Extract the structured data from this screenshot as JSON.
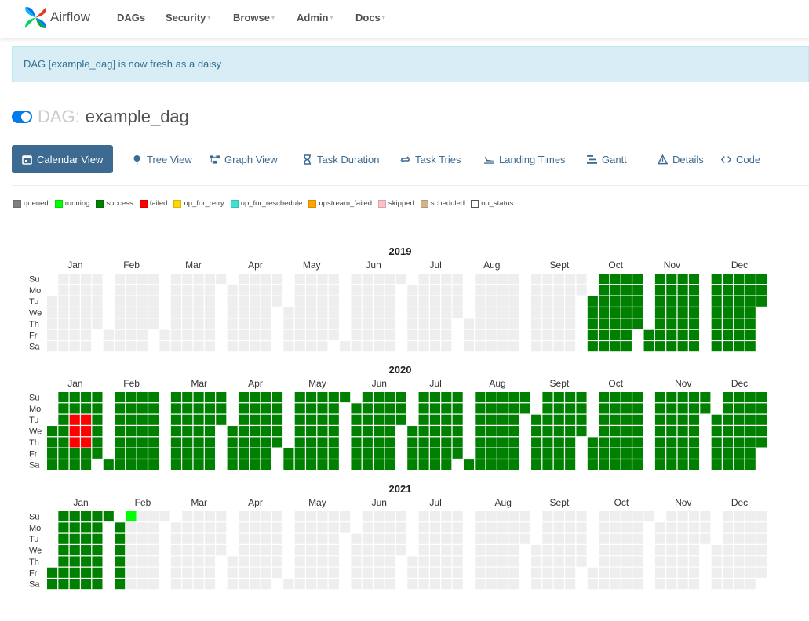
{
  "navbar": {
    "brand": "Airflow",
    "items": [
      {
        "label": "DAGs",
        "caret": false
      },
      {
        "label": "Security",
        "caret": true
      },
      {
        "label": "Browse",
        "caret": true
      },
      {
        "label": "Admin",
        "caret": true
      },
      {
        "label": "Docs",
        "caret": true
      }
    ]
  },
  "alert": {
    "message": "DAG [example_dag] is now fresh as a daisy"
  },
  "dag": {
    "prefix": "DAG:",
    "name": "example_dag",
    "paused": false
  },
  "tabs": [
    {
      "label": "Calendar View",
      "icon": "calendar-icon",
      "active": true
    },
    {
      "label": "Tree View",
      "icon": "pin-icon",
      "active": false
    },
    {
      "label": "Graph View",
      "icon": "graph-icon",
      "active": false
    },
    {
      "label": "Task Duration",
      "icon": "hourglass-icon",
      "active": false
    },
    {
      "label": "Task Tries",
      "icon": "retry-icon",
      "active": false
    },
    {
      "label": "Landing Times",
      "icon": "plane-landing-icon",
      "active": false
    },
    {
      "label": "Gantt",
      "icon": "gantt-icon",
      "active": false
    },
    {
      "label": "Details",
      "icon": "warning-triangle-icon",
      "active": false
    },
    {
      "label": "Code",
      "icon": "code-icon",
      "active": false
    }
  ],
  "legend": [
    {
      "label": "queued",
      "color": "#808080"
    },
    {
      "label": "running",
      "color": "#00ff00"
    },
    {
      "label": "success",
      "color": "#008000"
    },
    {
      "label": "failed",
      "color": "#ff0000"
    },
    {
      "label": "up_for_retry",
      "color": "#ffd700"
    },
    {
      "label": "up_for_reschedule",
      "color": "#40e0d0"
    },
    {
      "label": "upstream_failed",
      "color": "#ffa500"
    },
    {
      "label": "skipped",
      "color": "#ffc0cb"
    },
    {
      "label": "scheduled",
      "color": "#d2b48c"
    },
    {
      "label": "no_status",
      "color": "#ffffff"
    }
  ],
  "calendar": {
    "day_labels": [
      "Su",
      "Mo",
      "Tu",
      "We",
      "Th",
      "Fr",
      "Sa"
    ],
    "empty_color": "#eeeeee",
    "years": [
      {
        "year": "2019",
        "months": [
          "Jan",
          "Feb",
          "Mar",
          "Apr",
          "May",
          "Jun",
          "Jul",
          "Aug",
          "Sept",
          "Oct",
          "Nov",
          "Dec"
        ],
        "status_ranges": [
          {
            "from": "2019-10-01",
            "to": "2019-12-31",
            "status": "success"
          }
        ]
      },
      {
        "year": "2020",
        "months": [
          "Jan",
          "Feb",
          "Mar",
          "Apr",
          "May",
          "Jun",
          "Jul",
          "Aug",
          "Sept",
          "Oct",
          "Nov",
          "Dec"
        ],
        "status_ranges": [
          {
            "from": "2020-01-01",
            "to": "2020-12-31",
            "status": "success"
          },
          {
            "from": "2020-01-14",
            "to": "2020-01-16",
            "status": "failed"
          },
          {
            "from": "2020-01-21",
            "to": "2020-01-23",
            "status": "failed"
          }
        ]
      },
      {
        "year": "2021",
        "months": [
          "Jan",
          "Feb",
          "Mar",
          "Apr",
          "May",
          "Jun",
          "Jul",
          "Aug",
          "Sept",
          "Oct",
          "Nov",
          "Dec"
        ],
        "status_ranges": [
          {
            "from": "2021-01-01",
            "to": "2021-02-06",
            "status": "success"
          },
          {
            "from": "2021-02-07",
            "to": "2021-02-07",
            "status": "running"
          }
        ]
      }
    ]
  }
}
